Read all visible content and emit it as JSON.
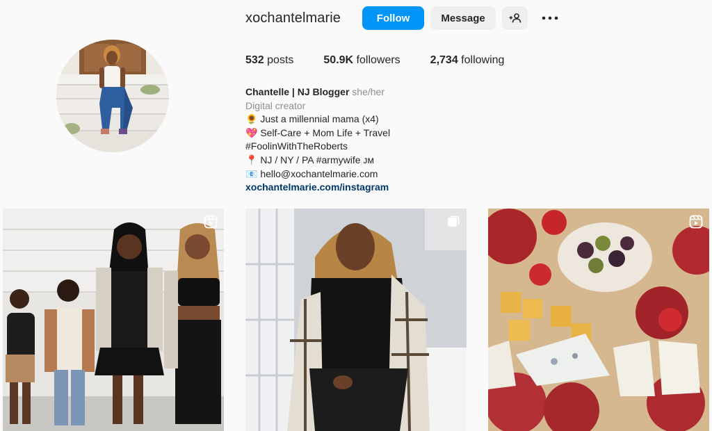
{
  "profile": {
    "username": "xochantelmarie",
    "follow_label": "Follow",
    "message_label": "Message",
    "stats": [
      {
        "value": "532",
        "label": " posts"
      },
      {
        "value": "50.9K",
        "label": " followers"
      },
      {
        "value": "2,734",
        "label": " following"
      }
    ],
    "bio": {
      "name": "Chantelle | NJ Blogger",
      "pronouns": "she/her",
      "category": "Digital creator",
      "lines": [
        "🌻 Just a millennial mama (x4)",
        "💖 Self-Care + Mom Life + Travel",
        "#FoolinWithTheRoberts",
        "📍 NJ / NY / PA #armywife ᴊᴍ",
        "📧 hello@xochantelmarie.com"
      ],
      "link": "xochantelmarie.com/instagram"
    }
  },
  "icons": {
    "add_user": "add-user-icon",
    "more": "more-options-icon",
    "reel": "reel-icon",
    "carousel": "carousel-icon"
  },
  "colors": {
    "primary": "#0095f6",
    "secondary_bg": "#efefef",
    "link": "#00376b",
    "muted": "#8e8e8e"
  },
  "posts": [
    {
      "type": "reel"
    },
    {
      "type": "carousel"
    },
    {
      "type": "reel"
    }
  ]
}
